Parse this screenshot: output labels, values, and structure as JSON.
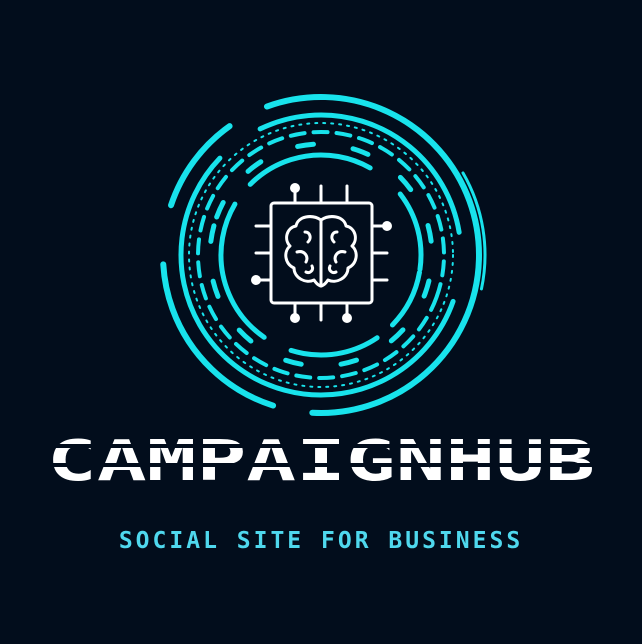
{
  "brand": {
    "name": "CAMPAIGNHUB",
    "tagline": "SOCIAL SITE FOR BUSINESS"
  },
  "icons": {
    "emblem": "circuit-rings-icon",
    "chip": "brain-chip-icon"
  },
  "colors": {
    "background": "#020d1c",
    "accent": "#18e3ec",
    "wordmark": "#ffffff",
    "tagline": "#4fd8ee"
  }
}
